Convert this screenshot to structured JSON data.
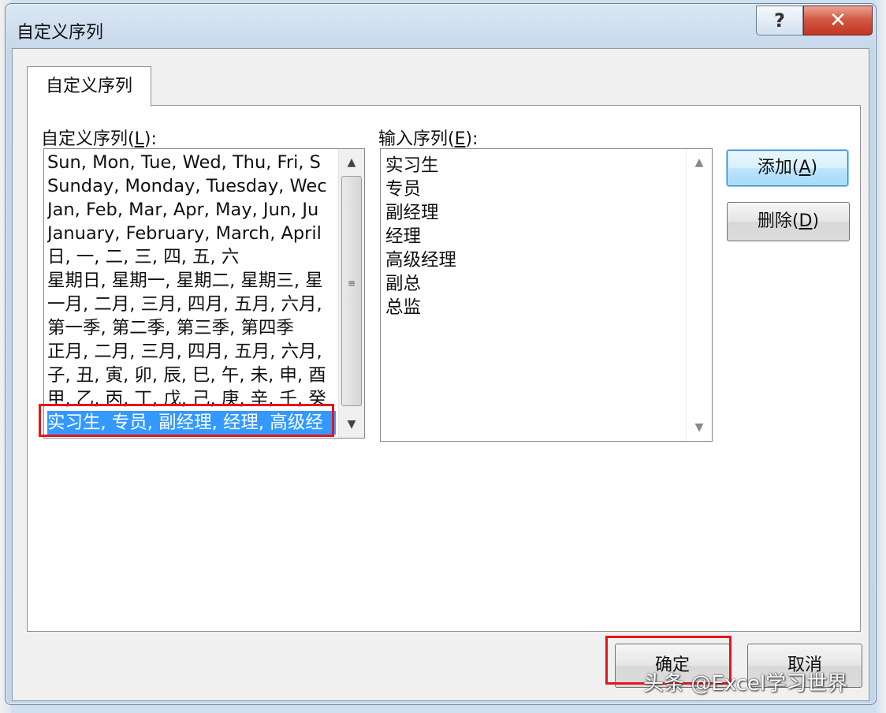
{
  "window": {
    "title": "自定义序列",
    "help_glyph": "?",
    "close_glyph": "✕"
  },
  "tab": {
    "label": "自定义序列"
  },
  "custom_lists": {
    "label_prefix": "自定义序列(",
    "label_key": "L",
    "label_suffix": "):",
    "items": [
      "Sun, Mon, Tue, Wed, Thu, Fri, S",
      "Sunday, Monday, Tuesday, Wec",
      "Jan, Feb, Mar, Apr, May, Jun, Ju",
      "January, February, March, April",
      "日, 一, 二, 三, 四, 五, 六",
      "星期日, 星期一, 星期二, 星期三, 星",
      "一月, 二月, 三月, 四月, 五月, 六月,",
      "第一季, 第二季, 第三季, 第四季",
      "正月, 二月, 三月, 四月, 五月, 六月,",
      "子, 丑, 寅, 卯, 辰, 巳, 午, 未, 申, 酉",
      "甲, 乙, 丙, 丁, 戊, 己, 庚, 辛, 壬, 癸",
      "实习生, 专员, 副经理, 经理, 高级经"
    ],
    "selected_index": 11
  },
  "input_entries": {
    "label_prefix": "输入序列(",
    "label_key": "E",
    "label_suffix": "):",
    "lines": [
      "实习生",
      "专员",
      "副经理",
      "经理",
      "高级经理",
      "副总",
      "总监"
    ]
  },
  "buttons": {
    "add_prefix": "添加(",
    "add_key": "A",
    "add_suffix": ")",
    "delete_prefix": "删除(",
    "delete_key": "D",
    "delete_suffix": ")",
    "ok": "确定",
    "cancel": "取消"
  },
  "scroll_icons": {
    "up": "▲",
    "down": "▼",
    "grip": "≡"
  },
  "colors": {
    "selection": "#3399ff",
    "highlight_box": "#e8141b",
    "close_button": "#c2351f"
  },
  "watermark": "头条 @Excel学习世界"
}
